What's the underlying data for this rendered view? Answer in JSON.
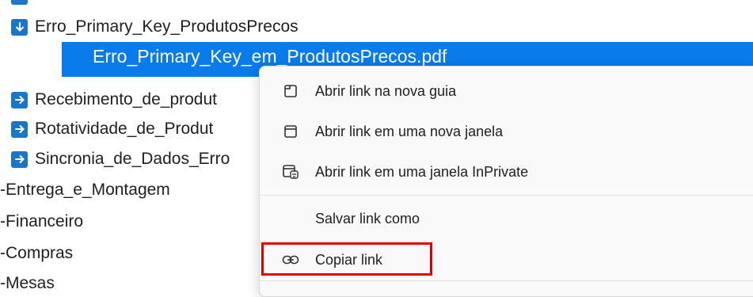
{
  "tree": {
    "download_item": "Erro_Primary_Key_ProdutosPrecos",
    "selected_file": "Erro_Primary_Key_em_ProdutosPrecos.pdf",
    "link_items": [
      "Recebimento_de_produt",
      "Rotatividade_de_Produt",
      "Sincronia_de_Dados_Erro"
    ],
    "folders": [
      "-Entrega_e_Montagem",
      "-Financeiro",
      "-Compras",
      "-Mesas"
    ]
  },
  "context_menu": {
    "items": [
      {
        "label": "Abrir link na nova guia",
        "icon": "new-tab-icon"
      },
      {
        "label": "Abrir link em uma nova janela",
        "icon": "new-window-icon"
      },
      {
        "label": "Abrir link em uma janela InPrivate",
        "icon": "inprivate-window-icon"
      },
      {
        "label": "Salvar link como",
        "icon": ""
      },
      {
        "label": "Copiar link",
        "icon": "link-icon"
      }
    ]
  },
  "colors": {
    "selection": "#0a7bea",
    "icon_blue": "#1976c8",
    "highlight_border": "#e00000"
  }
}
